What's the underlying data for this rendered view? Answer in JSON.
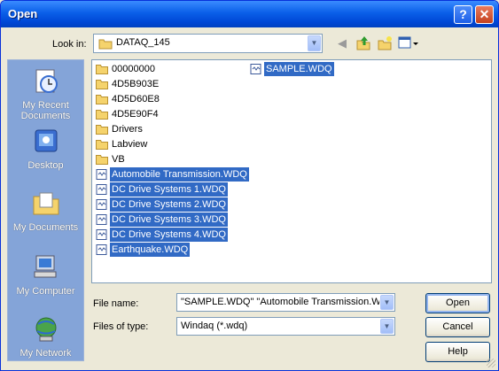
{
  "window": {
    "title": "Open"
  },
  "look_in": {
    "label": "Look in:",
    "value": "DATAQ_145"
  },
  "toolbar_icons": [
    "back-icon",
    "up-folder-icon",
    "new-folder-icon",
    "view-menu-icon"
  ],
  "places": [
    {
      "label": "My Recent Documents",
      "icon": "recent-documents-icon"
    },
    {
      "label": "Desktop",
      "icon": "desktop-icon"
    },
    {
      "label": "My Documents",
      "icon": "my-documents-icon"
    },
    {
      "label": "My Computer",
      "icon": "my-computer-icon"
    },
    {
      "label": "My Network",
      "icon": "my-network-icon"
    }
  ],
  "files": [
    {
      "name": "00000000",
      "type": "folder",
      "selected": false
    },
    {
      "name": "4D5B903E",
      "type": "folder",
      "selected": false
    },
    {
      "name": "4D5D60E8",
      "type": "folder",
      "selected": false
    },
    {
      "name": "4D5E90F4",
      "type": "folder",
      "selected": false
    },
    {
      "name": "Drivers",
      "type": "folder",
      "selected": false
    },
    {
      "name": "Labview",
      "type": "folder",
      "selected": false
    },
    {
      "name": "VB",
      "type": "folder",
      "selected": false
    },
    {
      "name": "Automobile Transmission.WDQ",
      "type": "file",
      "selected": true
    },
    {
      "name": "DC Drive Systems 1.WDQ",
      "type": "file",
      "selected": true
    },
    {
      "name": "DC Drive Systems 2.WDQ",
      "type": "file",
      "selected": true
    },
    {
      "name": "DC Drive Systems 3.WDQ",
      "type": "file",
      "selected": true
    },
    {
      "name": "DC Drive Systems 4.WDQ",
      "type": "file",
      "selected": true
    },
    {
      "name": "Earthquake.WDQ",
      "type": "file",
      "selected": true
    },
    {
      "name": "SAMPLE.WDQ",
      "type": "file",
      "selected": true
    }
  ],
  "file_name": {
    "label": "File name:",
    "value": "\"SAMPLE.WDQ\" \"Automobile Transmission.W"
  },
  "files_of_type": {
    "label": "Files of type:",
    "value": "Windaq (*.wdq)"
  },
  "buttons": {
    "open": "Open",
    "cancel": "Cancel",
    "help": "Help"
  },
  "colors": {
    "titlebar": "#0a5fe8",
    "selection": "#316ac5",
    "places_bar": "#84a4d8",
    "dialog_bg": "#ece9d8"
  }
}
